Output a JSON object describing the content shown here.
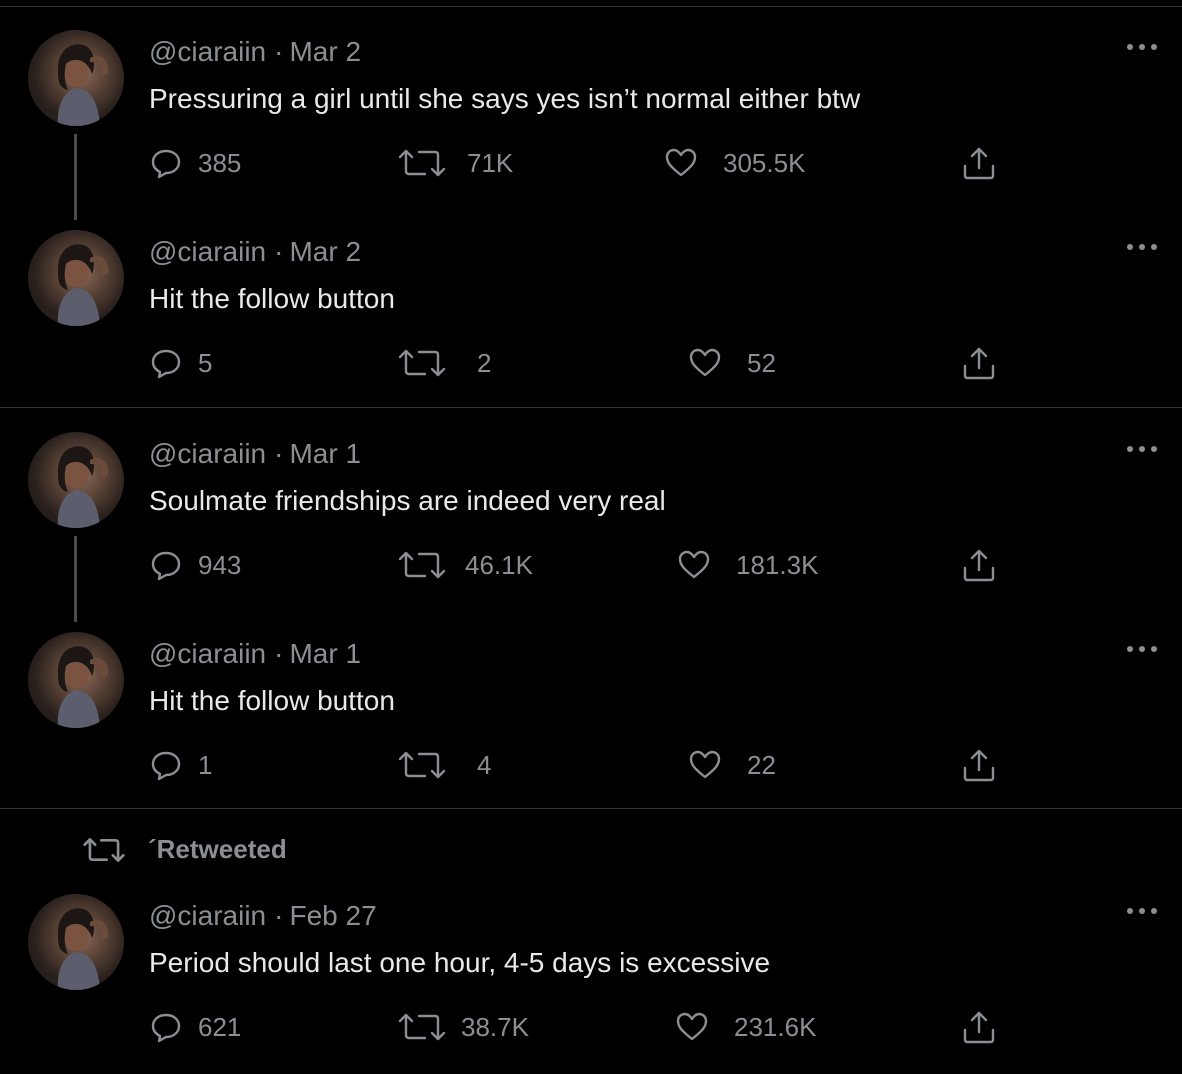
{
  "timeline": {
    "retweet_banner": "´Retweeted",
    "tweets": [
      {
        "handle": "@ciaraiin",
        "separator": "·",
        "date": "Mar 2",
        "text": "Pressuring a girl until she says yes isn’t normal either btw",
        "replies": "385",
        "retweets": "71K",
        "likes": "305.5K"
      },
      {
        "handle": "@ciaraiin",
        "separator": "·",
        "date": "Mar 2",
        "text": "Hit the follow button",
        "replies": "5",
        "retweets": "2",
        "likes": "52"
      },
      {
        "handle": "@ciaraiin",
        "separator": "·",
        "date": "Mar 1",
        "text": "Soulmate friendships are indeed very real",
        "replies": "943",
        "retweets": "46.1K",
        "likes": "181.3K"
      },
      {
        "handle": "@ciaraiin",
        "separator": "·",
        "date": "Mar 1",
        "text": "Hit the follow button",
        "replies": "1",
        "retweets": "4",
        "likes": "22"
      },
      {
        "handle": "@ciaraiin",
        "separator": "·",
        "date": "Feb 27",
        "text": "Period should last one hour, 4-5 days is excessive",
        "replies": "621",
        "retweets": "38.7K",
        "likes": "231.6K"
      }
    ]
  },
  "icons": {
    "reply": "reply-icon",
    "retweet": "retweet-icon",
    "like": "like-icon",
    "share": "share-icon",
    "more": "more-icon"
  },
  "colors": {
    "background": "#000000",
    "text": "#e7e9ea",
    "muted": "#8b8f93",
    "divider": "#2f3336"
  }
}
